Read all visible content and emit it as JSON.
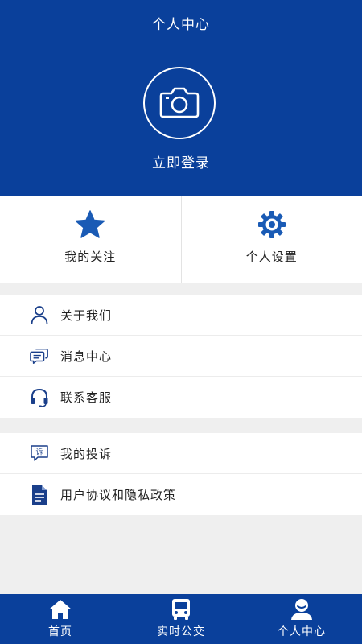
{
  "header": {
    "title": "个人中心",
    "login_label": "立即登录"
  },
  "quick_actions": [
    {
      "label": "我的关注",
      "icon": "star-icon"
    },
    {
      "label": "个人设置",
      "icon": "gear-icon"
    }
  ],
  "menu_group_1": [
    {
      "label": "关于我们",
      "icon": "user-outline-icon"
    },
    {
      "label": "消息中心",
      "icon": "chat-bubbles-icon"
    },
    {
      "label": "联系客服",
      "icon": "headset-icon"
    }
  ],
  "menu_group_2": [
    {
      "label": "我的投诉",
      "icon": "complaint-icon",
      "icon_text": "诉"
    },
    {
      "label": "用户协议和隐私政策",
      "icon": "document-icon"
    }
  ],
  "bottom_nav": [
    {
      "label": "首页",
      "icon": "home-icon"
    },
    {
      "label": "实时公交",
      "icon": "bus-icon"
    },
    {
      "label": "个人中心",
      "icon": "user-filled-icon"
    }
  ],
  "colors": {
    "primary": "#0a409b",
    "icon_blue": "#1a5bb5",
    "background": "#efefef"
  }
}
